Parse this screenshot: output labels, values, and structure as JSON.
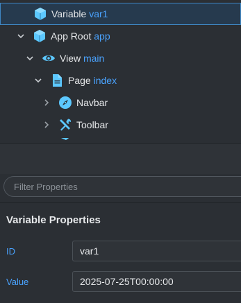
{
  "tree": {
    "items": [
      {
        "name": "Variable",
        "id": "var1",
        "icon": "cube-icon",
        "chevron": "none",
        "selected": true
      },
      {
        "name": "App Root",
        "id": "app",
        "icon": "cube-icon",
        "chevron": "expanded"
      },
      {
        "name": "View",
        "id": "main",
        "icon": "eye-icon",
        "chevron": "expanded"
      },
      {
        "name": "Page",
        "id": "index",
        "icon": "document-icon",
        "chevron": "expanded"
      },
      {
        "name": "Navbar",
        "id": "",
        "icon": "compass-icon",
        "chevron": "collapsed"
      },
      {
        "name": "Toolbar",
        "id": "",
        "icon": "tools-icon",
        "chevron": "collapsed"
      }
    ]
  },
  "filter": {
    "placeholder": "Filter Properties",
    "value": ""
  },
  "properties": {
    "title": "Variable Properties",
    "fields": [
      {
        "label": "ID",
        "value": "var1"
      },
      {
        "label": "Value",
        "value": "2025-07-25T00:00:00"
      }
    ]
  },
  "colors": {
    "background": "#2b2f34",
    "accent": "#4aa3ff",
    "icon_blue": "#5cc8ff",
    "selected_bg": "#263a4e",
    "selected_border": "#3f88c5"
  }
}
